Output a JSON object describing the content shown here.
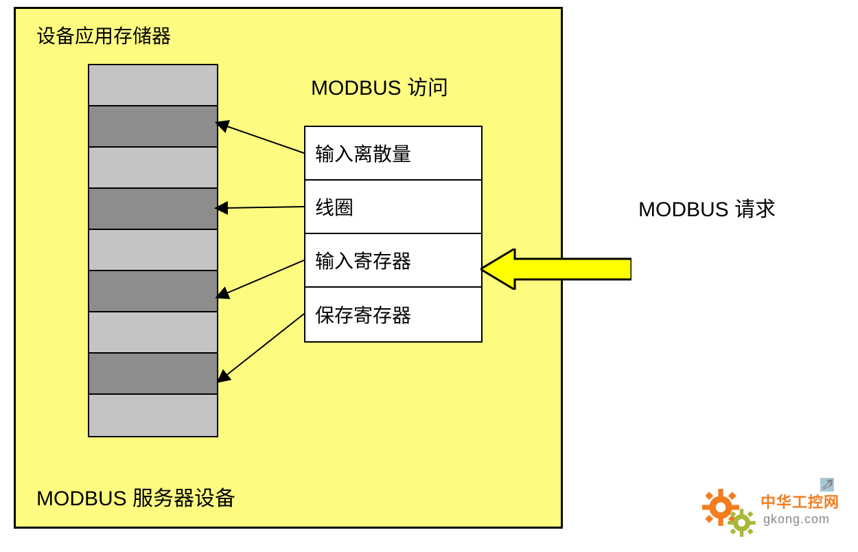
{
  "device_title": "设备应用存储器",
  "modbus_access_title": "MODBUS 访问",
  "access_rows": {
    "r0": "输入离散量",
    "r1": "线圈",
    "r2": "输入寄存器",
    "r3": "保存寄存器"
  },
  "server_label": "MODBUS 服务器设备",
  "request_label": "MODBUS 请求",
  "watermark": {
    "brand": "中华工控网",
    "domain": "gkong.com"
  },
  "colors": {
    "device_bg": "#fefc80",
    "mem_light": "#c4c4c4",
    "mem_dark": "#8d8d8d",
    "arrow_fill": "#ffff00",
    "gear_orange": "#f47c20",
    "gear_olive": "#a8b83a"
  }
}
